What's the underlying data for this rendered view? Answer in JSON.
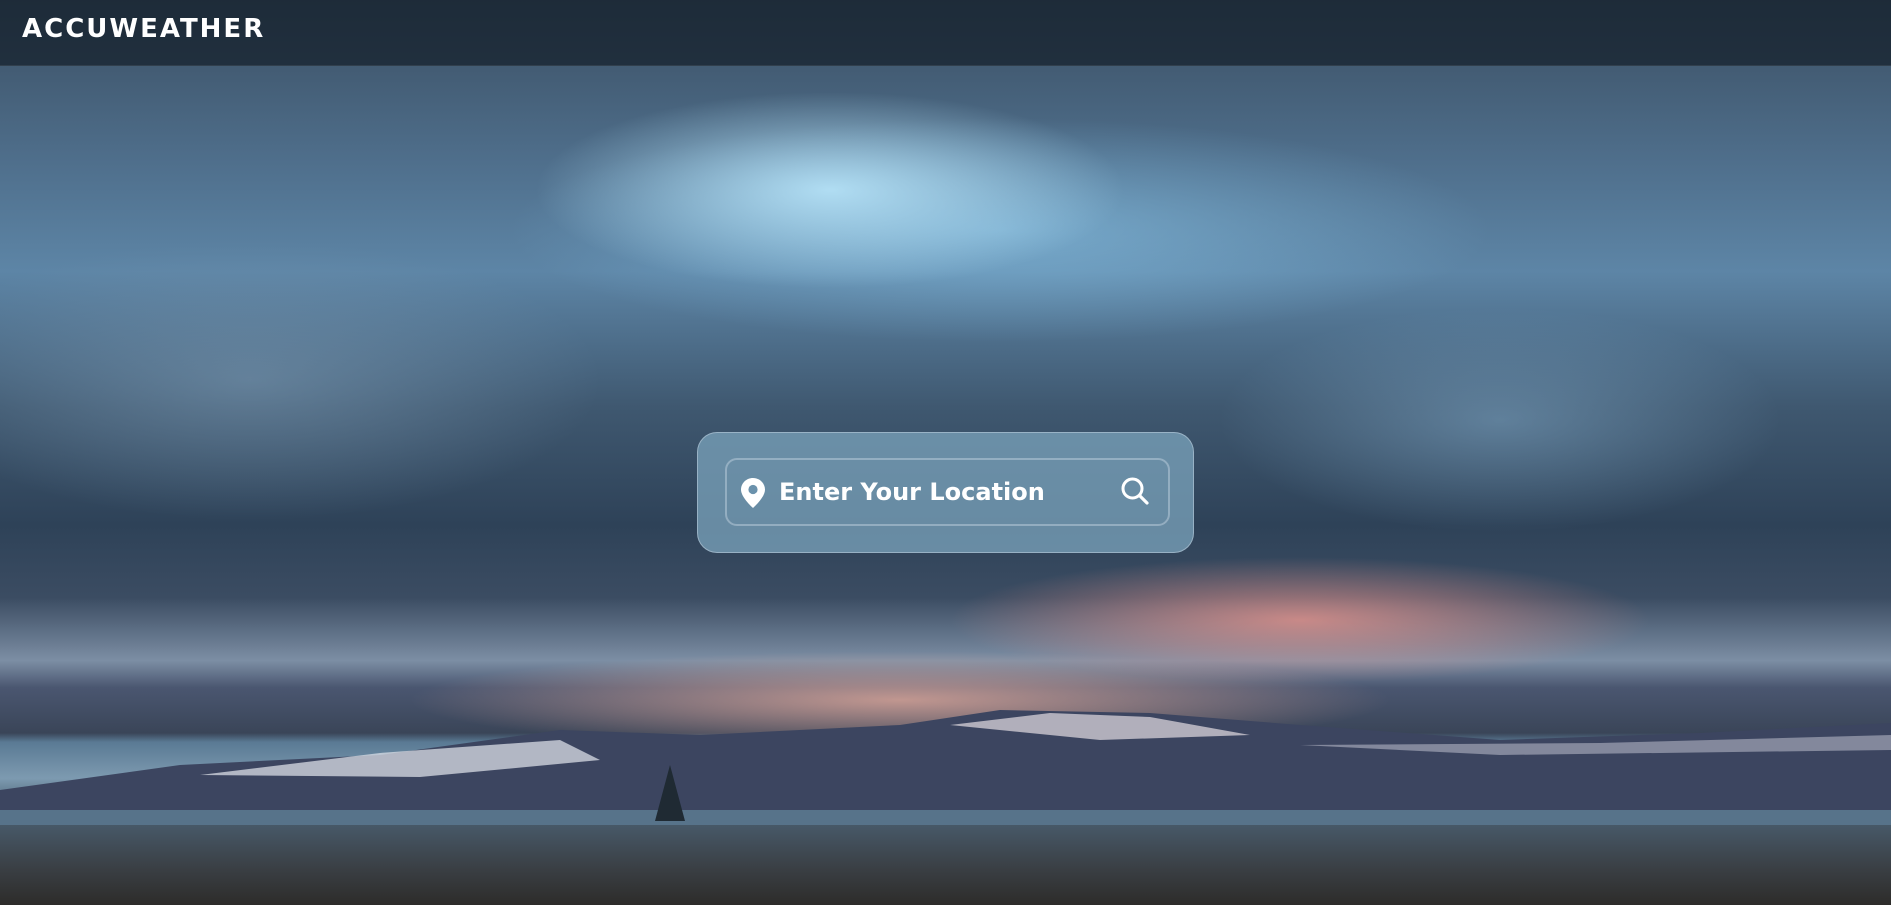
{
  "header": {
    "logo": "ACCUWEATHER"
  },
  "search": {
    "placeholder": "Enter Your Location",
    "value": "",
    "location_icon": "map-pin-icon",
    "search_icon": "magnifying-glass-icon"
  },
  "colors": {
    "card": "#6b92ac",
    "text": "#ffffff",
    "header": "#1e2b38"
  }
}
